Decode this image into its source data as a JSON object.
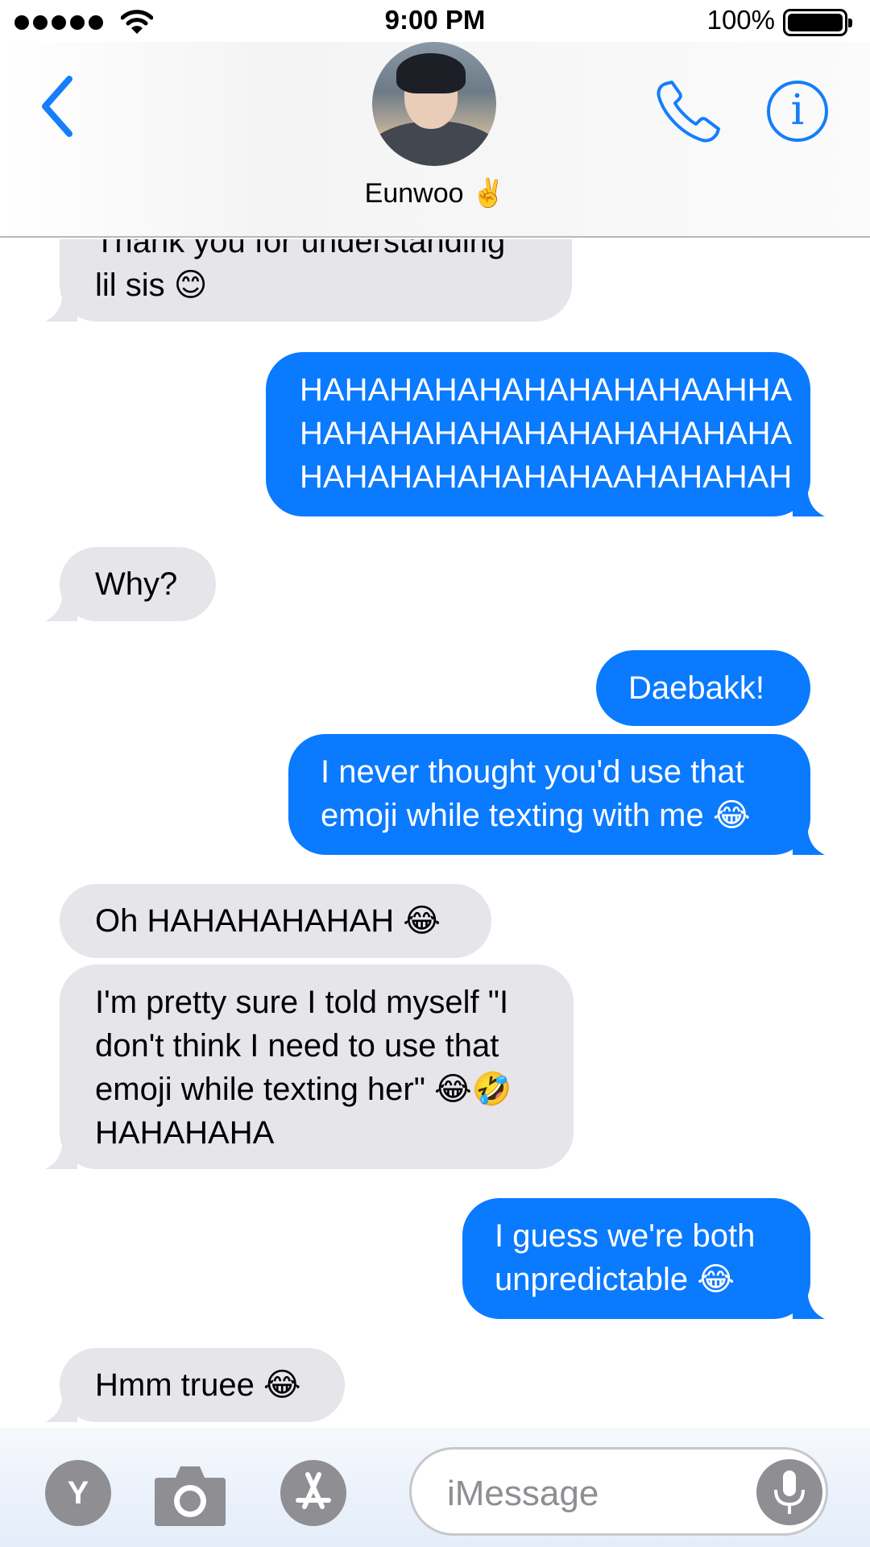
{
  "status_bar": {
    "time": "9:00 PM",
    "battery_percent": "100%",
    "battery_level": 1.0,
    "signal_bars": 5
  },
  "header": {
    "contact_name": "Eunwoo ✌️"
  },
  "messages": [
    {
      "direction": "received",
      "text": "Thank you for understanding\nlil sis 😊"
    },
    {
      "direction": "sent",
      "text": "HAHAHAHAHAHAHAHAHAAHHA\nHAHAHAHAHAHAHAHAHAHAHA\nHAHAHAHAHAHAHAAHAHAHAH"
    },
    {
      "direction": "received",
      "text": "Why?"
    },
    {
      "direction": "sent",
      "text": "Daebakk!"
    },
    {
      "direction": "sent",
      "text": "I never thought you'd use that\nemoji while texting with me 😂"
    },
    {
      "direction": "received",
      "text": "Oh HAHAHAHAHAH 😂"
    },
    {
      "direction": "received",
      "text": "I'm pretty sure I told myself \"I\ndon't think I need to use that\nemoji while texting her\" 😂🤣\nHAHAHAHA"
    },
    {
      "direction": "sent",
      "text": "I guess we're both\nunpredictable 😂"
    },
    {
      "direction": "received",
      "text": "Hmm truee 😂"
    }
  ],
  "composer": {
    "placeholder": "iMessage",
    "y_button_label": "Y"
  },
  "colors": {
    "accent_blue": "#147efb",
    "sent_bubble": "#0a7aff",
    "received_bubble": "#e5e5ea",
    "icon_gray": "#8e8e93"
  }
}
